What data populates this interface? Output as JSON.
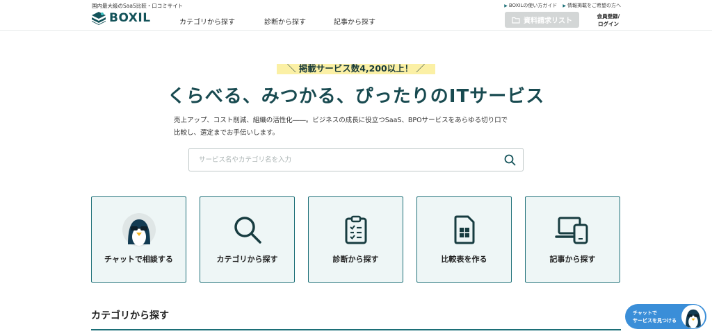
{
  "header": {
    "tagline": "国内最大級のSaaS比較・口コミサイト",
    "logo": "BOXIL",
    "nav": [
      "カテゴリから探す",
      "診断から探す",
      "記事から探す"
    ],
    "toplinks": [
      "BOXILの使い方ガイド",
      "情報掲載をご希望の方へ"
    ],
    "request_button": "資料請求リスト",
    "login": [
      "会員登録/",
      "ログイン"
    ]
  },
  "hero": {
    "banner": "掲載サービス数4,200以上！",
    "title": "くらべる、みつかる、ぴったりのITサービス",
    "description_line1": "売上アップ、コスト削減、組織の活性化――。ビジネスの成長に役立つSaaS、BPOサービスをあらゆる切り口で",
    "description_line2": "比較し、選定までお手伝いします。",
    "search_placeholder": "サービス名やカテゴリ名を入力"
  },
  "cards": [
    {
      "label": "チャットで相談する",
      "icon": "penguin-avatar-icon"
    },
    {
      "label": "カテゴリから探す",
      "icon": "search-icon"
    },
    {
      "label": "診断から探す",
      "icon": "clipboard-checklist-icon"
    },
    {
      "label": "比較表を作る",
      "icon": "spreadsheet-icon"
    },
    {
      "label": "記事から探す",
      "icon": "devices-icon"
    }
  ],
  "section": {
    "title": "カテゴリから探す"
  },
  "chat_widget": {
    "line1": "チャットで",
    "line2": "サービスを見つける"
  },
  "colors": {
    "accent": "#1c6f77",
    "card_bg": "#eef6f6",
    "banner": "#fbf0a5",
    "chat": "#3a8ed8"
  }
}
